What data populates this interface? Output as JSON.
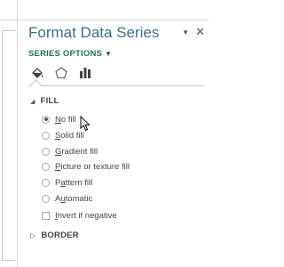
{
  "pane": {
    "title": "Format Data Series",
    "dropdown_icon": "chevron-down-icon",
    "close_icon": "close-icon"
  },
  "series_options": {
    "label": "SERIES OPTIONS",
    "chevron_icon": "chevron-down-icon"
  },
  "tabs": [
    {
      "name": "fill-line-tab",
      "icon": "paint-bucket-icon"
    },
    {
      "name": "effects-tab",
      "icon": "pentagon-icon"
    },
    {
      "name": "series-options-tab",
      "icon": "bar-chart-icon"
    }
  ],
  "fill": {
    "header": "FILL",
    "options": [
      {
        "label": "No fill",
        "mnemonic": "N",
        "rest": "o fill",
        "selected": true
      },
      {
        "label": "Solid fill",
        "mnemonic": "S",
        "rest": "olid fill",
        "selected": false
      },
      {
        "label": "Gradient fill",
        "mnemonic": "G",
        "rest": "radient fill",
        "selected": false
      },
      {
        "label": "Picture or texture fill",
        "mnemonic": "P",
        "rest": "icture or texture fill",
        "selected": false
      },
      {
        "label": "Pattern fill",
        "mnemonic": "a",
        "pre": "P",
        "rest": "ttern fill",
        "selected": false
      },
      {
        "label": "Automatic",
        "mnemonic": "u",
        "pre": "A",
        "rest": "tomatic",
        "selected": false
      }
    ],
    "invert": {
      "label": "Invert if negative",
      "mnemonic": "I",
      "rest": "nvert if negative",
      "checked": false
    }
  },
  "border": {
    "header": "BORDER"
  },
  "colors": {
    "title": "#3e6e8a",
    "accent": "#217346",
    "text": "#444444"
  }
}
